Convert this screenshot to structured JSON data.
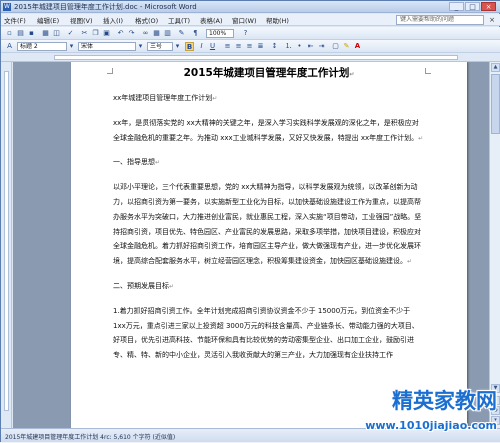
{
  "window": {
    "title": "2015年城建项目管理年度工作计划.doc - Microsoft Word",
    "minimize": "_",
    "maximize": "□",
    "close": "×"
  },
  "menu": {
    "items": [
      "文件(F)",
      "编辑(E)",
      "视图(V)",
      "插入(I)",
      "格式(O)",
      "工具(T)",
      "表格(A)",
      "窗口(W)",
      "帮助(H)"
    ],
    "help_placeholder": "键入需要帮助的问题",
    "help_close": "×"
  },
  "toolbar": {
    "style": "标题 2",
    "font": "宋体",
    "size": "三号",
    "bold": "B",
    "italic": "I",
    "underline": "U",
    "font_color": "A",
    "zoom": "100%"
  },
  "document": {
    "title": "2015年城建项目管理年度工作计划",
    "paragraphs": [
      "xx年城建项目管理年度工作计划",
      "xx年，是贯彻落实党的 xx大精神的关键之年，是深入学习实践科学发展观的深化之年，是积极应对全球金融危机的重要之年。为推动 xxx工业城科学发展，又好又快发展，特提出 xx年度工作计划。",
      "一、指导思想",
      "以邓小平理论，三个代表重要思想，党的 xx大精神为指导，以科学发展观为统领，以改革创新为动力，以招商引资为第一要务，以实施新型工业化为目标，以加快基础设施建设工作为重点，以提高帮办服务水平为突破口，大力推进创业富民，就业惠民工程，深入实施“项目带动，工业强园”战略。坚持招商引资，项目优先、特色园区、产业富民的发展思路，采取多项举措，加快项目建设，积极应对全球金融危机。着力抓好招商引资工作，培育园区主导产业，做大做强现有产业，进一步优化发展环境，提高综合配套服务水平，树立经营园区理念，积极筹集建设资金，加快园区基础设施建设。",
      "二、预期发展目标",
      "1.着力抓好招商引资工作。全年计划完成招商引资协议资金不少于 15000万元，到位资金不少于 1xx万元，重点引进三家以上投资超 3000万元的科技含量高、产业链条长、带动能力强的大项目、好项目，优先引进高科技、节能环保和具有比较优势的劳动密集型企业、出口加工企业，鼓励引进专、精、特、新的中小企业，灵活引入我收贡献大的第三产业，大力加强现有企业扶持工作"
    ]
  },
  "status": {
    "text": "2015年城建项目管理年度工作计划  4rc: 5,610 个字符 (近似值)"
  },
  "watermark": {
    "main": "精英家教网",
    "url": "www.1010jiajiao.com"
  }
}
